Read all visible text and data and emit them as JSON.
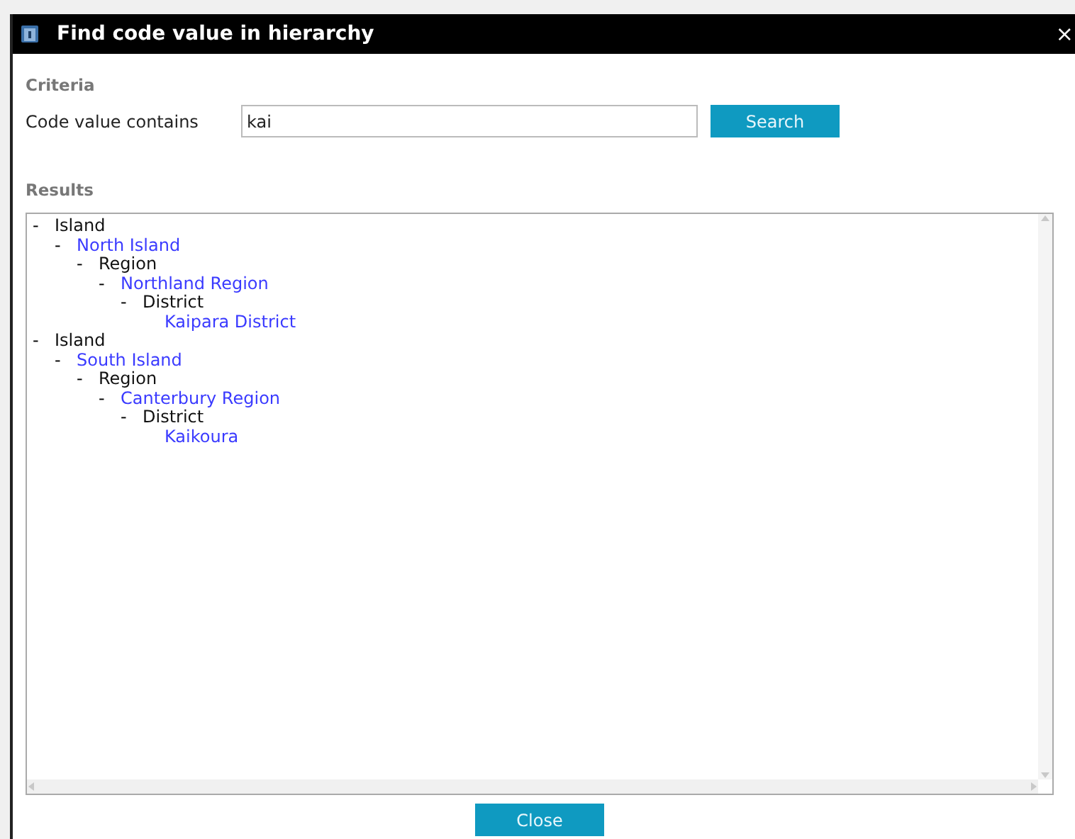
{
  "window": {
    "title": "Find code value in hierarchy",
    "close": "×"
  },
  "criteria": {
    "heading": "Criteria",
    "label": "Code value contains",
    "value": "kai",
    "button": "Search"
  },
  "results": {
    "heading": "Results",
    "tree": [
      {
        "toggle": "-",
        "label": "Island",
        "kind": "type",
        "children": [
          {
            "toggle": "-",
            "label": "North Island",
            "kind": "value",
            "children": [
              {
                "toggle": "-",
                "label": "Region",
                "kind": "type",
                "children": [
                  {
                    "toggle": "-",
                    "label": "Northland Region",
                    "kind": "value",
                    "children": [
                      {
                        "toggle": "-",
                        "label": "District",
                        "kind": "type",
                        "children": [
                          {
                            "label": "Kaipara District",
                            "kind": "value"
                          }
                        ]
                      }
                    ]
                  }
                ]
              }
            ]
          }
        ]
      },
      {
        "toggle": "-",
        "label": "Island",
        "kind": "type",
        "children": [
          {
            "toggle": "-",
            "label": "South Island",
            "kind": "value",
            "children": [
              {
                "toggle": "-",
                "label": "Region",
                "kind": "type",
                "children": [
                  {
                    "toggle": "-",
                    "label": "Canterbury Region",
                    "kind": "value",
                    "children": [
                      {
                        "toggle": "-",
                        "label": "District",
                        "kind": "type",
                        "children": [
                          {
                            "label": "Kaikoura",
                            "kind": "value"
                          }
                        ]
                      }
                    ]
                  }
                ]
              }
            ]
          }
        ]
      }
    ]
  },
  "buttons": [
    "Close"
  ]
}
